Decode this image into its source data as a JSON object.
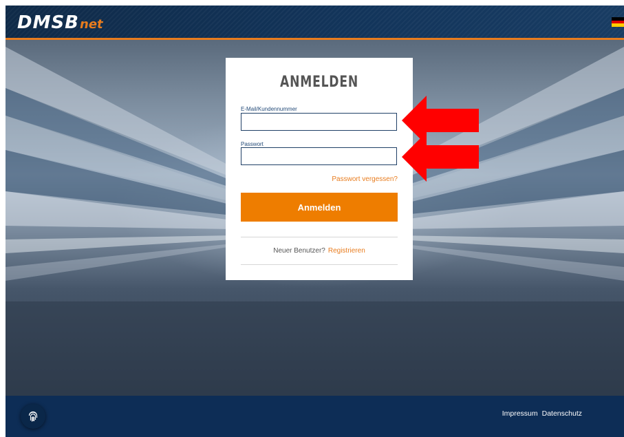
{
  "header": {
    "logo_main": "DMSB",
    "logo_sub": "net",
    "language_flag_icon": "flag-de-icon",
    "brand_orange": "#e87c1e",
    "brand_blue": "#12345a"
  },
  "login": {
    "title": "ANMELDEN",
    "email_label": "E-Mail/Kundennummer",
    "email_value": "",
    "password_label": "Passwort",
    "password_value": "",
    "forgot_link": "Passwort vergessen?",
    "submit_label": "Anmelden",
    "new_user_text": "Neuer Benutzer?",
    "register_link": "Registrieren"
  },
  "footer": {
    "fingerprint_icon": "fingerprint-icon",
    "links": [
      "Impressum",
      "Datenschutz"
    ]
  },
  "annotations": {
    "arrow_color": "#ff0000",
    "arrow_icon": "left-arrow-icon"
  }
}
